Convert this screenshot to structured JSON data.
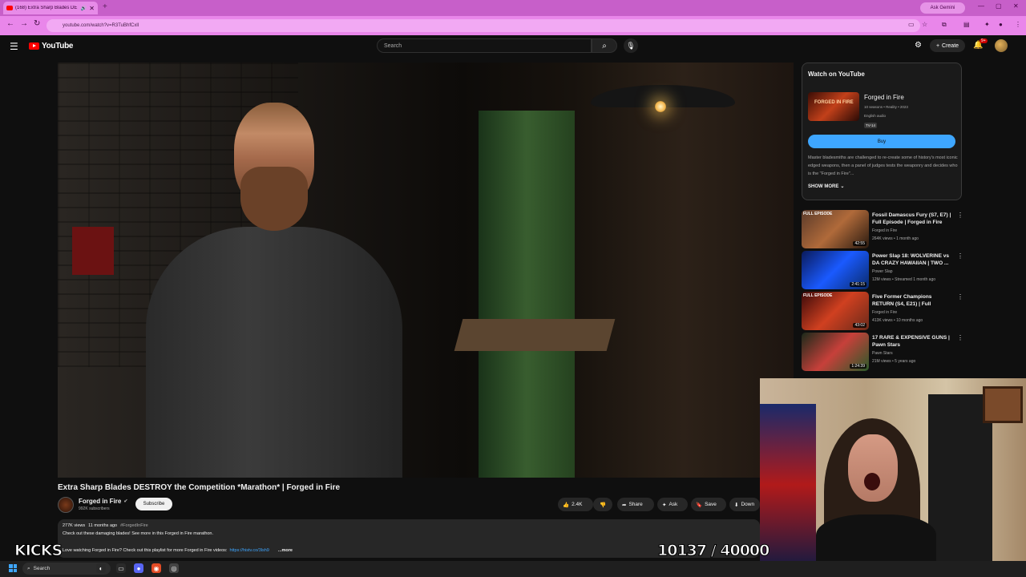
{
  "browser": {
    "tab_title": "(168) Extra Sharp Blades DE",
    "new_tab": "+",
    "gemini_label": "Ask Gemini",
    "url": "youtube.com/watch?v=R3TuBhfCxlI",
    "accent": "#c75fc9"
  },
  "yt_header": {
    "logo": "YouTube",
    "search_placeholder": "Search",
    "create_label": "Create",
    "notifications_count": "9+"
  },
  "video": {
    "title": "Extra Sharp Blades DESTROY the Competition *Marathon* | Forged in Fire",
    "channel": "Forged in Fire",
    "subscribers": "992K subscribers",
    "subscribe_label": "Subscribe",
    "likes": "2.4K",
    "share_label": "Share",
    "ask_label": "Ask",
    "save_label": "Save",
    "download_label": "Down"
  },
  "description": {
    "views": "277K views",
    "age": "11 months ago",
    "hashtag": "#ForgedInFire",
    "line1": "Check out these damaging blades! See more in this Forged in Fire marathon.",
    "line2_prefix": "Love watching Forged in Fire? Check out this playlist for more Forged in Fire videos:",
    "line2_link": "https://histv.co/3lsh9",
    "more": "...more"
  },
  "watch_panel": {
    "heading": "Watch on YouTube",
    "thumb_text": "FORGED IN FIRE",
    "show_name": "Forged in Fire",
    "info": "10 seasons • Reality • 2023",
    "audio": "English audio",
    "rating": "TV-14",
    "buy_label": "Buy",
    "desc": "Master bladesmiths are challenged to re-create some of history's most iconic edged weapons, then a panel of judges tests the weaponry and decides who is the \"Forged in Fire\"...",
    "show_more": "SHOW MORE"
  },
  "recommendations": [
    {
      "badge": "FULL EPISODE",
      "duration": "42:55",
      "title": "Fossil Damascus Fury (S7, E7) | Full Episode | Forged in Fire",
      "channel": "Forged in Fire",
      "meta": "264K views • 1 month ago"
    },
    {
      "badge": "",
      "duration": "2:41:15",
      "title": "Power Slap 18: WOLVERINE vs DA CRAZY HAWAIIAN | TWO ...",
      "channel": "Power Slap",
      "meta": "12M views • Streamed 1 month ago"
    },
    {
      "badge": "FULL EPISODE",
      "duration": "43:02",
      "title": "Five Former Champions RETURN (S4, E21) | Full Episod...",
      "channel": "Forged in Fire",
      "meta": "413K views • 10 months ago"
    },
    {
      "badge": "",
      "duration": "1:24:39",
      "title": "17 RARE & EXPENSIVE GUNS | Pawn Stars",
      "channel": "Pawn Stars",
      "meta": "21M views • 5 years ago"
    }
  ],
  "overlays": {
    "kicks": "KICKS",
    "counter": "10137 / 40000"
  },
  "taskbar": {
    "search_label": "Search"
  }
}
